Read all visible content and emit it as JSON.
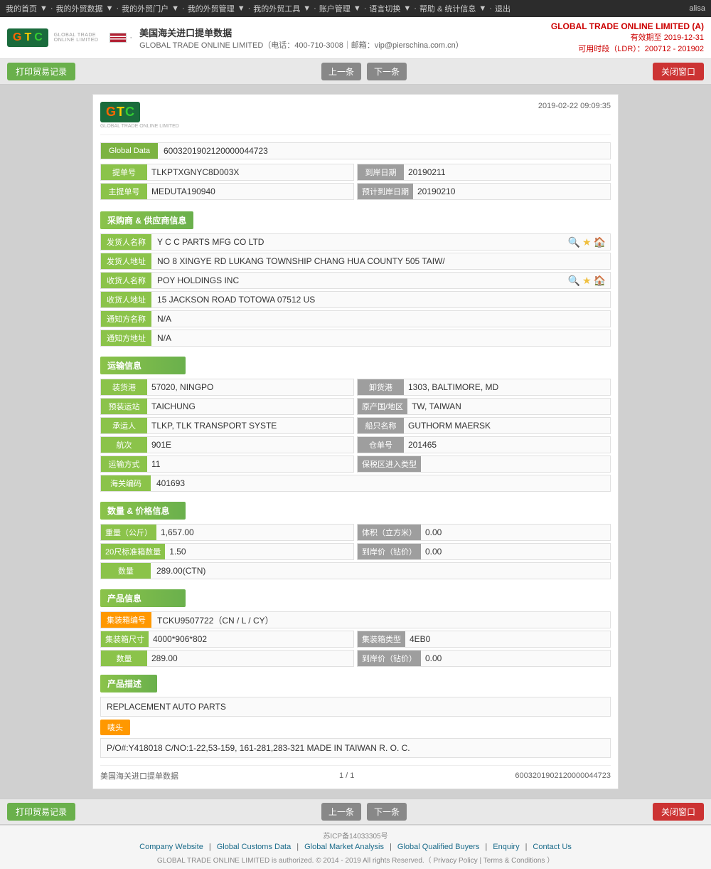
{
  "topnav": {
    "links": [
      "我的首页",
      "我的外贸数据",
      "我的外贸门户",
      "我的外贸管理",
      "我的外贸工具",
      "账户管理",
      "语言切换",
      "帮助 & 统计信息",
      "退出"
    ],
    "user": "alisa"
  },
  "header": {
    "title": "美国海关进口提单数据",
    "company": "GLOBAL TRADE ONLINE LIMITED（电话：400-710-3008｜邮箱：vip@pierschina.com.cn）",
    "brand": "GLOBAL TRADE ONLINE LIMITED (A)",
    "valid_until": "有效期至 2019-12-31",
    "ldr": "可用时段（LDR）：200712 - 201902"
  },
  "toolbar": {
    "print_btn": "打印贸易记录",
    "prev_btn": "上一条",
    "next_btn": "下一条",
    "close_btn": "关闭窗口"
  },
  "document": {
    "timestamp": "2019-02-22 09:09:35",
    "global_data_label": "Global Data",
    "global_data_value": "6003201902120000044723",
    "bill_no_label": "提单号",
    "bill_no_value": "TLKPTXGNYC8D003X",
    "arrival_date_label": "到岸日期",
    "arrival_date_value": "20190211",
    "master_bill_label": "主提单号",
    "master_bill_value": "MEDUTA190940",
    "estimated_date_label": "预计到岸日期",
    "estimated_date_value": "20190210"
  },
  "shipper_section": {
    "title": "采购商 & 供应商信息",
    "shipper_name_label": "发货人名称",
    "shipper_name_value": "Y C C PARTS MFG CO LTD",
    "shipper_addr_label": "发货人地址",
    "shipper_addr_value": "NO 8 XINGYE RD LUKANG TOWNSHIP CHANG HUA COUNTY 505 TAIW/",
    "consignee_name_label": "收货人名称",
    "consignee_name_value": "POY HOLDINGS INC",
    "consignee_addr_label": "收货人地址",
    "consignee_addr_value": "15 JACKSON ROAD TOTOWA 07512 US",
    "notify_name_label": "通知方名称",
    "notify_name_value": "N/A",
    "notify_addr_label": "通知方地址",
    "notify_addr_value": "N/A"
  },
  "shipping_section": {
    "title": "运输信息",
    "loading_port_label": "装货港",
    "loading_port_value": "57020, NINGPO",
    "discharge_port_label": "卸货港",
    "discharge_port_value": "1303, BALTIMORE, MD",
    "pre_carriage_label": "预装运站",
    "pre_carriage_value": "TAICHUNG",
    "origin_label": "原产国/地区",
    "origin_value": "TW, TAIWAN",
    "carrier_label": "承运人",
    "carrier_value": "TLKP, TLK TRANSPORT SYSTE",
    "vessel_label": "船只名称",
    "vessel_value": "GUTHORM MAERSK",
    "voyage_label": "航次",
    "voyage_value": "901E",
    "warehouse_label": "仓单号",
    "warehouse_value": "201465",
    "transport_label": "运输方式",
    "transport_value": "11",
    "bonded_label": "保税区进入类型",
    "bonded_value": "",
    "customs_label": "海关编码",
    "customs_value": "401693"
  },
  "quantity_section": {
    "title": "数量 & 价格信息",
    "weight_label": "重量（公斤）",
    "weight_value": "1,657.00",
    "volume_label": "体积（立方米）",
    "volume_value": "0.00",
    "std_container_label": "20尺标准箱数量",
    "std_container_value": "1.50",
    "arrival_price_label": "到岸价（钻价）",
    "arrival_price_value": "0.00",
    "quantity_label": "数量",
    "quantity_value": "289.00(CTN)"
  },
  "product_section": {
    "title": "产品信息",
    "container_no_label": "集装箱编号",
    "container_no_value": "TCKU9507722（CN / L / CY）",
    "container_size_label": "集装箱尺寸",
    "container_size_value": "4000*906*802",
    "container_type_label": "集装箱类型",
    "container_type_value": "4EB0",
    "qty_label": "数量",
    "qty_value": "289.00",
    "arrival_price_label": "到岸价（钻价）",
    "arrival_price_value": "0.00",
    "product_desc_label": "产品描述",
    "product_desc_value": "REPLACEMENT AUTO PARTS",
    "mark_label": "唛头",
    "mark_value": "P/O#:Y418018 C/NO:1-22,53-159, 161-281,283-321 MADE IN TAIWAN R. O. C."
  },
  "footer_doc": {
    "data_source": "美国海关进口提单数据",
    "pagination": "1 / 1",
    "record_id": "6003201902120000044723"
  },
  "bottom_footer": {
    "icp": "苏ICP备14033305号",
    "links": [
      "Company Website",
      "Global Customs Data",
      "Global Market Analysis",
      "Global Qualified Buyers",
      "Enquiry",
      "Contact Us"
    ],
    "copyright": "GLOBAL TRADE ONLINE LIMITED is authorized. © 2014 - 2019 All rights Reserved.（",
    "privacy": "Privacy Policy",
    "separator": "|",
    "terms": "Terms & Conditions",
    "end": "）"
  }
}
